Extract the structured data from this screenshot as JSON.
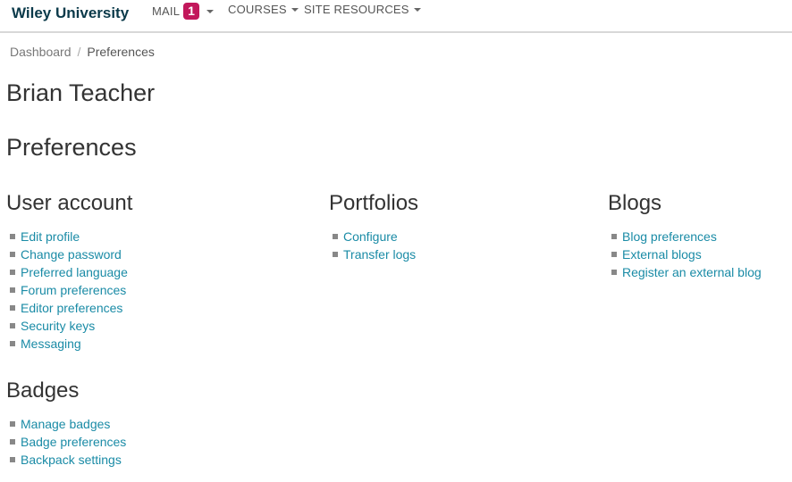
{
  "navbar": {
    "brand": "Wiley University",
    "mail_label": "MAIL",
    "mail_count": "1",
    "courses_label": "COURSES",
    "site_resources_label": "SITE RESOURCES"
  },
  "breadcrumb": {
    "dashboard": "Dashboard",
    "separator": "/",
    "current": "Preferences"
  },
  "user_name": "Brian Teacher",
  "page_title": "Preferences",
  "sections": {
    "user_account": {
      "title": "User account",
      "links": [
        "Edit profile",
        "Change password",
        "Preferred language",
        "Forum preferences",
        "Editor preferences",
        "Security keys",
        "Messaging"
      ]
    },
    "badges": {
      "title": "Badges",
      "links": [
        "Manage badges",
        "Badge preferences",
        "Backpack settings"
      ]
    },
    "portfolios": {
      "title": "Portfolios",
      "links": [
        "Configure",
        "Transfer logs"
      ]
    },
    "blogs": {
      "title": "Blogs",
      "links": [
        "Blog preferences",
        "External blogs",
        "Register an external blog"
      ]
    }
  },
  "colors": {
    "brand": "#0b3a4a",
    "link": "#1a8ba6",
    "badge": "#c2185b"
  }
}
